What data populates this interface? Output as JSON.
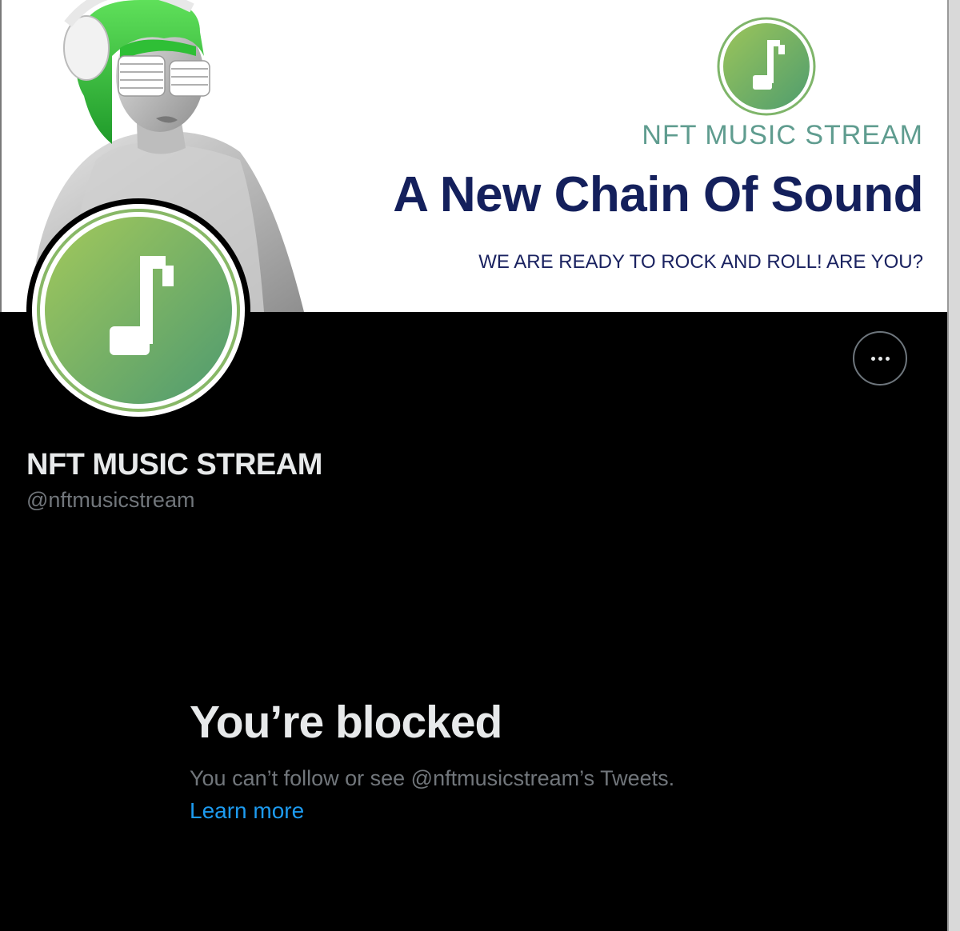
{
  "banner": {
    "brand": "NFT MUSIC STREAM",
    "headline": "A New Chain Of Sound",
    "tagline": "WE ARE READY TO ROCK AND ROLL! ARE YOU?",
    "logo_icon": "music-note-icon"
  },
  "profile": {
    "display_name": "NFT MUSIC STREAM",
    "handle": "@nftmusicstream",
    "avatar_icon": "music-note-icon",
    "more_icon": "more-options-icon"
  },
  "blocked": {
    "title": "You’re blocked",
    "description": "You can’t follow or see @nftmusicstream’s Tweets.",
    "learn_more": "Learn more"
  },
  "colors": {
    "background": "#000000",
    "accent_link": "#1d9bf0",
    "brand_navy": "#14205c",
    "brand_green": "#7fb56a"
  }
}
